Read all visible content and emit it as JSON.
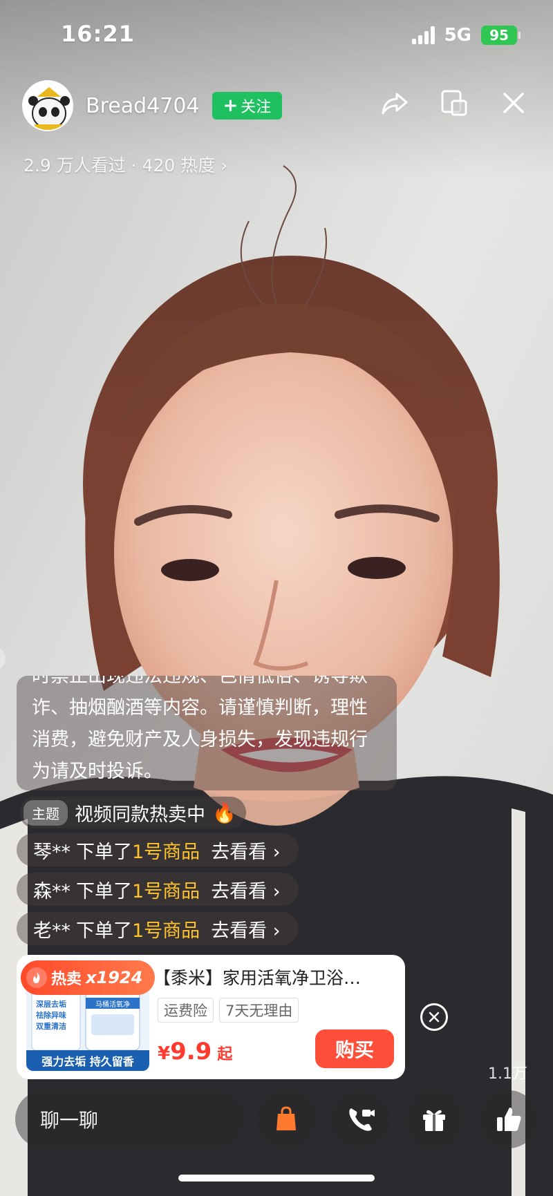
{
  "status_bar": {
    "time": "16:21",
    "network": "5G",
    "battery": "95"
  },
  "header": {
    "streamer_name": "Bread4704",
    "follow_label": "关注",
    "follow_plus": "+",
    "viewer_stats": "2.9 万人看过 · 420 热度 ›",
    "icons": [
      "share-icon",
      "screen-cast-icon",
      "close-icon"
    ]
  },
  "notice": {
    "text": "时禁止出现违法违规、色情低俗、诱导欺诈、抽烟酗酒等内容。请谨慎判断，理性消费，避免财产及人身损失，发现违规行为请及时投诉。"
  },
  "topic": {
    "tag": "主题",
    "text": "视频同款热卖中",
    "icon": "🔥"
  },
  "orders": [
    {
      "user": "琴**",
      "action": "下单了",
      "product": "1号商品",
      "link": "去看看 ›"
    },
    {
      "user": "森**",
      "action": "下单了",
      "product": "1号商品",
      "link": "去看看 ›"
    },
    {
      "user": "老**",
      "action": "下单了",
      "product": "1号商品",
      "link": "去看看 ›"
    }
  ],
  "product": {
    "hot_label": "热卖",
    "hot_count": "x1924",
    "title": "【黍米】家用活氧净卫浴…",
    "tags": [
      "运费险",
      "7天无理由"
    ],
    "price_currency": "¥",
    "price_value": "9.9",
    "price_suffix": "起",
    "buy_label": "购买",
    "image_slogan": "强力去垢 持久留香",
    "image_lines": [
      "深层去垢",
      "祛除异味",
      "双重清洁"
    ],
    "image_brand": "马桶活氧净"
  },
  "like_count": "1.1万",
  "bottom_bar": {
    "chat_placeholder": "聊一聊",
    "icons": [
      "shopping-bag-icon",
      "video-call-icon",
      "gift-icon",
      "like-icon"
    ]
  },
  "colors": {
    "follow_green": "#1fc060",
    "accent_orange": "#ff4f3a",
    "order_product_yellow": "#ffc32b",
    "battery_green": "#2fc651"
  }
}
